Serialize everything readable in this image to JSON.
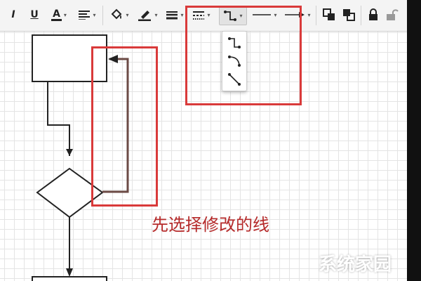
{
  "toolbar": {
    "italic_label": "I",
    "underline_label": "U",
    "font_color_label": "A",
    "accent_color": "#d93a3a"
  },
  "icons": {
    "italic": "italic-icon",
    "underline": "underline-icon",
    "font_color": "font-color-icon",
    "align": "align-left-icon",
    "fill": "fill-bucket-icon",
    "line_color": "pen-icon",
    "line_width": "line-width-icon",
    "line_dash": "dash-pattern-icon",
    "waypoints": "waypoint-orthogonal-icon",
    "line_start": "line-start-icon",
    "line_end": "line-end-arrow-icon",
    "to_front": "bring-to-front-icon",
    "to_back": "send-to-back-icon",
    "lock": "lock-icon",
    "unlock": "unlock-icon"
  },
  "waypoint_menu": {
    "options": [
      "orthogonal",
      "curved",
      "straight"
    ]
  },
  "annotation": "先选择修改的线",
  "watermark": "系统家园"
}
